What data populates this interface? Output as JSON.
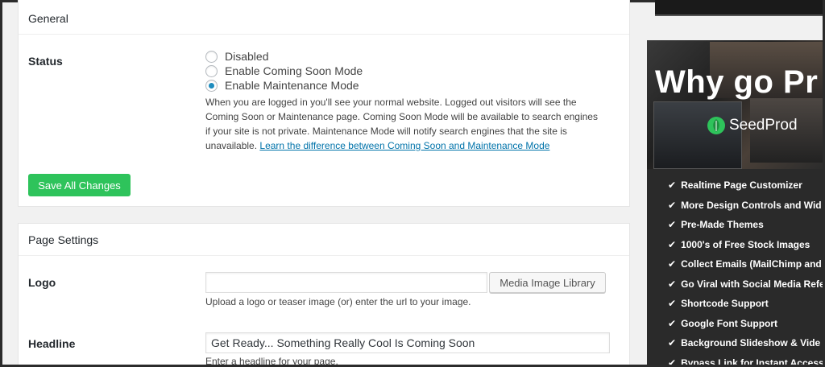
{
  "general": {
    "title": "General",
    "status_label": "Status",
    "status_options": [
      {
        "label": "Disabled",
        "checked": false
      },
      {
        "label": "Enable Coming Soon Mode",
        "checked": false
      },
      {
        "label": "Enable Maintenance Mode",
        "checked": true
      }
    ],
    "description_lines": [
      "When you are logged in you'll see your normal website. Logged out visitors will see the",
      "Coming Soon or Maintenance page. Coming Soon Mode will be available to search engines",
      "if your site is not private. Maintenance Mode will notify search engines that the site is",
      "unavailable."
    ],
    "description_link": "Learn the difference between Coming Soon and Maintenance Mode",
    "save_label": "Save All Changes"
  },
  "page_settings": {
    "title": "Page Settings",
    "logo_label": "Logo",
    "logo_value": "",
    "media_button": "Media Image Library",
    "logo_hint": "Upload a logo or teaser image (or) enter the url to your image.",
    "headline_label": "Headline",
    "headline_value": "Get Ready... Something Really Cool Is Coming Soon",
    "headline_hint": "Enter a headline for your page."
  },
  "promo": {
    "title": "Why go Pr",
    "brand": "SeedProd",
    "features": [
      "Realtime Page Customizer",
      "More Design Controls and Wid",
      "Pre-Made Themes",
      "1000's of Free Stock Images",
      "Collect Emails (MailChimp and",
      "Go Viral with Social Media Refe",
      "Shortcode Support",
      "Google Font Support",
      "Background Slideshow & Vide",
      "Bypass Link for Instant Access"
    ],
    "check_glyph": "✔"
  },
  "colors": {
    "save_button": "#2ec35b",
    "radio_checked": "#1e8cbe",
    "link": "#0073aa"
  }
}
